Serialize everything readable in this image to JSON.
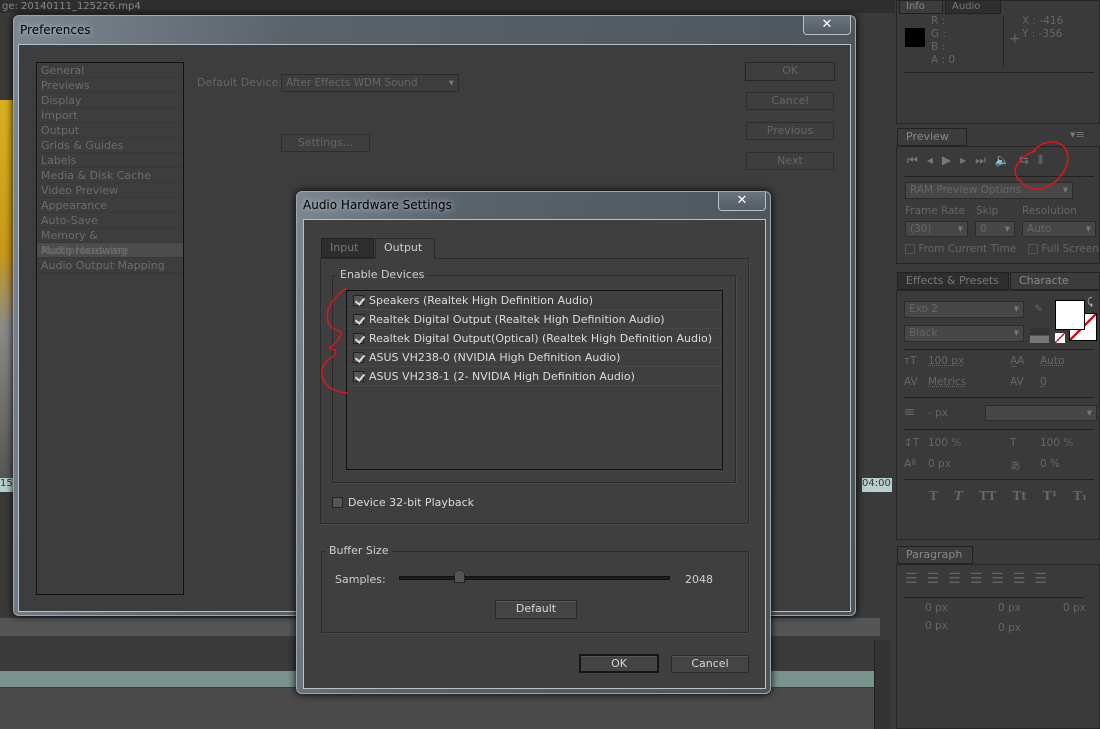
{
  "background": {
    "tab_partial": "ge: 20140111_125226.mp4",
    "timecode_left": "15",
    "timecode_right": "04:00"
  },
  "preferences": {
    "title": "Preferences",
    "categories": [
      "General",
      "Previews",
      "Display",
      "Import",
      "Output",
      "Grids & Guides",
      "Labels",
      "Media & Disk Cache",
      "Video Preview",
      "Appearance",
      "Auto-Save",
      "Memory & Multiprocessing",
      "Audio Hardware",
      "Audio Output Mapping"
    ],
    "selected_category": "Audio Hardware",
    "default_device_label": "Default Device:",
    "default_device_value": "After Effects WDM Sound",
    "settings_button": "Settings...",
    "ok": "OK",
    "cancel": "Cancel",
    "previous": "Previous",
    "next": "Next",
    "close": "✕"
  },
  "audio_dialog": {
    "title": "Audio Hardware Settings",
    "close": "✕",
    "tabs": [
      "Input",
      "Output"
    ],
    "active_tab": "Output",
    "enable_devices_label": "Enable Devices",
    "devices": [
      {
        "name": "Speakers (Realtek High Definition Audio)",
        "checked": true
      },
      {
        "name": "Realtek Digital Output (Realtek High Definition Audio)",
        "checked": true
      },
      {
        "name": "Realtek Digital Output(Optical) (Realtek High Definition Audio)",
        "checked": true
      },
      {
        "name": "ASUS VH238-0 (NVIDIA High Definition Audio)",
        "checked": true
      },
      {
        "name": "ASUS VH238-1 (2- NVIDIA High Definition Audio)",
        "checked": true
      }
    ],
    "playback_32bit_label": "Device 32-bit Playback",
    "playback_32bit_checked": false,
    "buffer_size_label": "Buffer Size",
    "samples_label": "Samples:",
    "samples_value": "2048",
    "default_button": "Default",
    "ok": "OK",
    "cancel": "Cancel"
  },
  "info_panel": {
    "tabs": [
      "Info",
      "Audio"
    ],
    "r": "R :",
    "g": "G :",
    "b": "B :",
    "a": "A : 0",
    "x": "X : -416",
    "y": "Y : -356"
  },
  "preview_panel": {
    "tab": "Preview",
    "ram_preview": "RAM Preview Options",
    "frame_rate_label": "Frame Rate",
    "frame_rate_value": "(30)",
    "skip_label": "Skip",
    "skip_value": "0",
    "resolution_label": "Resolution",
    "resolution_value": "Auto",
    "from_current_time": "From Current Time",
    "full_screen": "Full Screen"
  },
  "character_panel": {
    "tabs": [
      "Effects & Presets",
      "Characte"
    ],
    "font": "Exo 2",
    "style": "Black",
    "size": "100 px",
    "leading": "Auto",
    "kerning": "Metrics",
    "tracking": "0",
    "stroke": "- px",
    "vscale": "100 %",
    "hscale": "100 %",
    "baseline": "0 px",
    "tsume": "0 %",
    "styles": [
      "T",
      "T",
      "TT",
      "Tt",
      "T¹",
      "T₁"
    ]
  },
  "paragraph_panel": {
    "tab": "Paragraph",
    "indent_left": "0 px",
    "indent_right": "0 px",
    "indent_first": "0 px",
    "space_before": "0 px",
    "space_after": "0 px"
  },
  "annotation_color": "#e0141e"
}
